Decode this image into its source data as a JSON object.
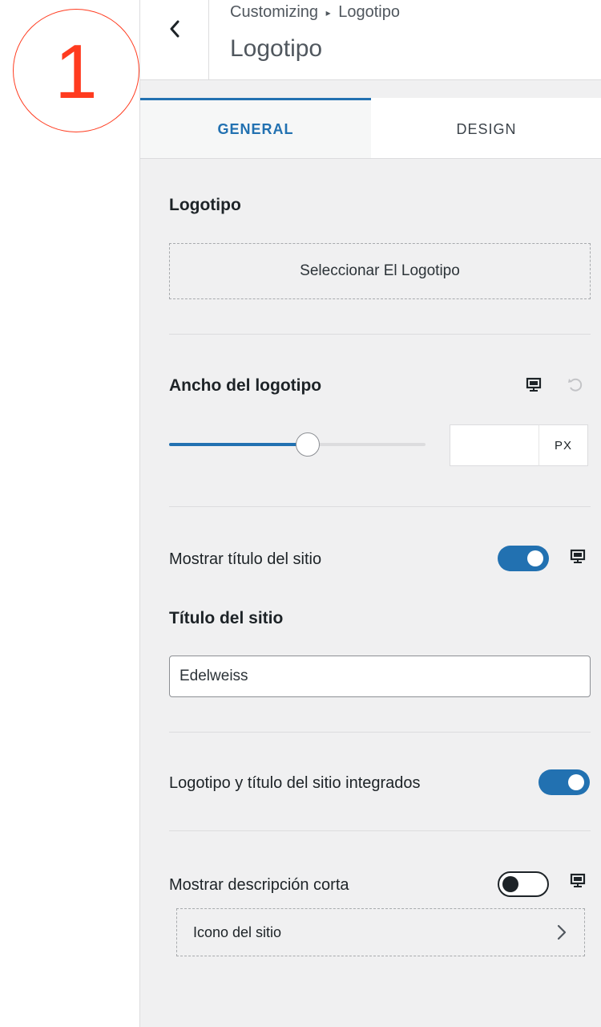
{
  "annotation": {
    "step": "1"
  },
  "header": {
    "breadcrumb_root": "Customizing",
    "breadcrumb_separator": "▸",
    "breadcrumb_current": "Logotipo",
    "title": "Logotipo"
  },
  "tabs": [
    {
      "label": "GENERAL",
      "active": true
    },
    {
      "label": "DESIGN",
      "active": false
    }
  ],
  "logo": {
    "label": "Logotipo",
    "select_button": "Seleccionar El Logotipo"
  },
  "logo_width": {
    "label": "Ancho del logotipo",
    "value": "",
    "unit": "PX",
    "slider_fraction": 0.54
  },
  "show_site_title": {
    "label": "Mostrar título del sitio",
    "enabled": true
  },
  "site_title": {
    "label": "Título del sitio",
    "value": "Edelweiss"
  },
  "integrated": {
    "label": "Logotipo y título del sitio integrados",
    "enabled": true
  },
  "short_description": {
    "label": "Mostrar descripción corta",
    "enabled": false
  },
  "site_icon": {
    "label": "Icono del sitio"
  },
  "colors": {
    "accent": "#2271b1",
    "annotation": "#ff3b1f",
    "panel_bg": "#f0f0f1"
  }
}
